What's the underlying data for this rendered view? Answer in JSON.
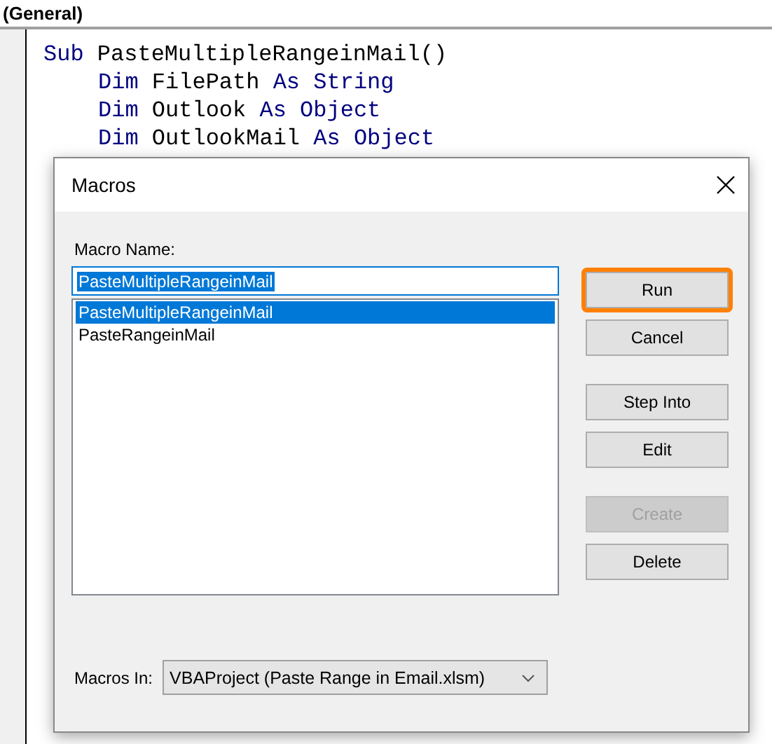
{
  "object_box": {
    "value": "(General)"
  },
  "code_lines": [
    {
      "indented": false,
      "segments": [
        {
          "text": "Sub",
          "kind": "keyword"
        },
        {
          "text": " PasteMultipleRangeinMail()",
          "kind": "plain"
        }
      ]
    },
    {
      "indented": true,
      "segments": [
        {
          "text": "Dim",
          "kind": "keyword"
        },
        {
          "text": " FilePath ",
          "kind": "plain"
        },
        {
          "text": "As String",
          "kind": "keyword"
        }
      ]
    },
    {
      "indented": true,
      "segments": [
        {
          "text": "Dim",
          "kind": "keyword"
        },
        {
          "text": " Outlook ",
          "kind": "plain"
        },
        {
          "text": "As Object",
          "kind": "keyword"
        }
      ]
    },
    {
      "indented": true,
      "segments": [
        {
          "text": "Dim",
          "kind": "keyword"
        },
        {
          "text": " OutlookMail ",
          "kind": "plain"
        },
        {
          "text": "As Object",
          "kind": "keyword"
        }
      ]
    }
  ],
  "dialog": {
    "title": "Macros",
    "macro_name": {
      "label": "Macro Name:",
      "value": "PasteMultipleRangeinMail"
    },
    "macros": [
      {
        "name": "PasteMultipleRangeinMail",
        "selected": true
      },
      {
        "name": "PasteRangeinMail",
        "selected": false
      }
    ],
    "button_groups": [
      [
        {
          "label": "Run",
          "highlighted": true,
          "disabled": false
        },
        {
          "label": "Cancel",
          "highlighted": false,
          "disabled": false
        }
      ],
      [
        {
          "label": "Step Into",
          "highlighted": false,
          "disabled": false
        },
        {
          "label": "Edit",
          "highlighted": false,
          "disabled": false
        }
      ],
      [
        {
          "label": "Create",
          "highlighted": false,
          "disabled": true
        },
        {
          "label": "Delete",
          "highlighted": false,
          "disabled": false
        }
      ]
    ],
    "macros_in": {
      "label": "Macros In:",
      "value": "VBAProject (Paste Range in Email.xlsm)"
    }
  }
}
